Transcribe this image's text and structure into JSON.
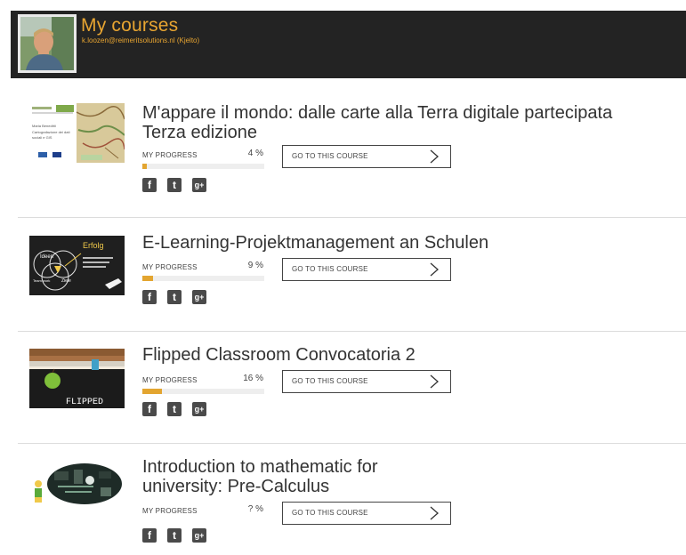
{
  "header": {
    "title": "My courses",
    "user": "k.loozen@reimeritsolutions.nl (Kjelto)"
  },
  "colors": {
    "accent": "#e3a530",
    "header_bg": "#232323"
  },
  "courses": [
    {
      "title_lines": [
        "M'appare il mondo: dalle carte alla Terra digitale partecipata",
        "Terza edizione"
      ],
      "progress_label": "MY PROGRESS",
      "progress_text": "4 %",
      "progress_fraction": 0.04,
      "button_label": "GO TO THIS COURSE",
      "thumb_text": {
        "line1": "Maria Beneditti",
        "line2": "Cartografazione dei dati",
        "line3": "sociali e GIS"
      }
    },
    {
      "title_lines": [
        "E-Learning-Projektmanagement an Schulen"
      ],
      "progress_label": "MY PROGRESS",
      "progress_text": "9 %",
      "progress_fraction": 0.09,
      "button_label": "GO TO THIS COURSE",
      "thumb_text": {
        "ideen": "Ideen",
        "erfolg": "Erfolg",
        "team": "Team work",
        "ziele": "Ziele"
      }
    },
    {
      "title_lines": [
        "Flipped Classroom Convocatoria 2"
      ],
      "progress_label": "MY PROGRESS",
      "progress_text": "16 %",
      "progress_fraction": 0.16,
      "button_label": "GO TO THIS COURSE",
      "thumb_text": {
        "word": "FLIPPED"
      }
    },
    {
      "title_lines": [
        "Introduction to mathematic for",
        "university: Pre-Calculus"
      ],
      "progress_label": "MY PROGRESS",
      "progress_text": "? %",
      "progress_fraction": 0,
      "button_label": "GO TO THIS COURSE",
      "thumb_text": {}
    }
  ],
  "social_icons": [
    "facebook-icon",
    "twitter-icon",
    "google-plus-icon"
  ],
  "social_glyphs": {
    "facebook": "f",
    "twitter": "t",
    "gplus": "g+"
  }
}
